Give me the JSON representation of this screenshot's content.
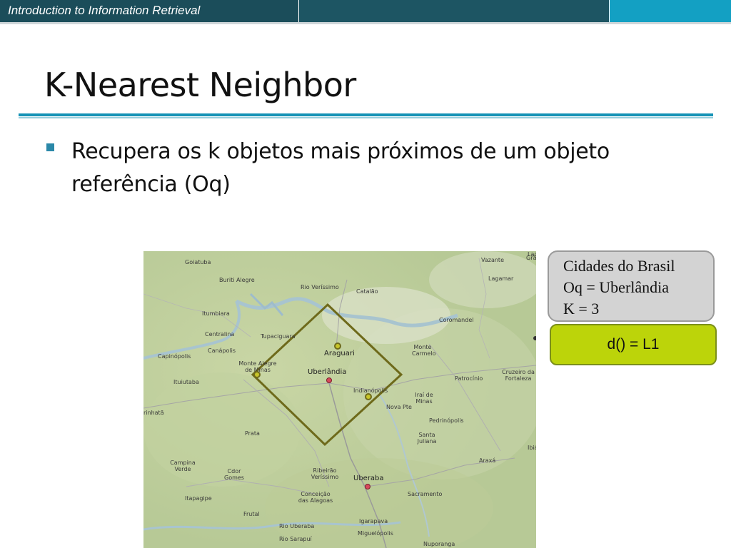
{
  "header": {
    "course_title": "Introduction to Information Retrieval"
  },
  "slide": {
    "title": "K-Nearest Neighbor",
    "bullet": "Recupera os k objetos mais próximos de um objeto referência (Oq)"
  },
  "info_box": {
    "line1": "Cidades do Brasil",
    "line2": "Oq = Uberlândia",
    "line3": "K = 3"
  },
  "distance_box": {
    "label": "d() = L1"
  },
  "map": {
    "query_city": "Uberlândia",
    "neighbors": [
      "Araguari",
      "Monte Alegre de Minas",
      "Indianópolis"
    ],
    "cities": [
      {
        "name": "Goiatuba"
      },
      {
        "name": "Buriti Alegre"
      },
      {
        "name": "Rio Veríssimo"
      },
      {
        "name": "Catalão"
      },
      {
        "name": "Vazante"
      },
      {
        "name": "Lagamar"
      },
      {
        "name": "Itumbiara"
      },
      {
        "name": "Centralina"
      },
      {
        "name": "Tupaciguara"
      },
      {
        "name": "Coromandel"
      },
      {
        "name": "Capinópolis"
      },
      {
        "name": "Canápolis"
      },
      {
        "name": "Araguari"
      },
      {
        "name": "Monte Carmelo"
      },
      {
        "name": "Monte Alegre de Minas"
      },
      {
        "name": "Uberlândia"
      },
      {
        "name": "Patrocínio"
      },
      {
        "name": "Cruzeiro da Fortaleza"
      },
      {
        "name": "Ituiutaba"
      },
      {
        "name": "Indianópolis"
      },
      {
        "name": "Iraí de Minas"
      },
      {
        "name": "Nova Pte"
      },
      {
        "name": "Pedrinópolis"
      },
      {
        "name": "rinhatã"
      },
      {
        "name": "Prata"
      },
      {
        "name": "Santa Juliana"
      },
      {
        "name": "Campina Verde"
      },
      {
        "name": "Cdor Gomes"
      },
      {
        "name": "Ribeirão Veríssimo"
      },
      {
        "name": "Uberaba"
      },
      {
        "name": "Araxá"
      },
      {
        "name": "Itapagipe"
      },
      {
        "name": "Conceição das Alagoas"
      },
      {
        "name": "Sacramento"
      },
      {
        "name": "Frutal"
      },
      {
        "name": "Igarapava"
      },
      {
        "name": "Rio Uberaba"
      },
      {
        "name": "Rio Sarapuí"
      },
      {
        "name": "Miguelópolis"
      },
      {
        "name": "Ibiá"
      },
      {
        "name": "Lag"
      },
      {
        "name": "Grã"
      },
      {
        "name": "Nuporanga"
      }
    ]
  }
}
